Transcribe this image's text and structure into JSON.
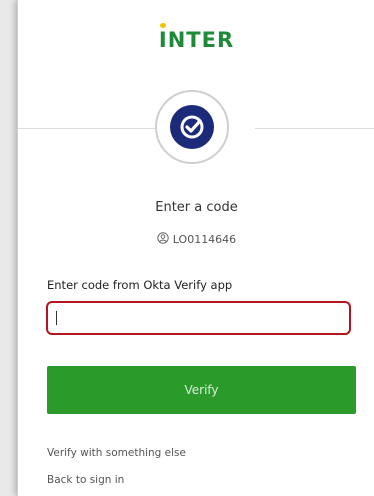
{
  "brand": {
    "logo_text": "INTER",
    "logo_color": "#1e8a3a",
    "logo_dot_color": "#f2c200"
  },
  "authenticator": {
    "icon": "okta-verify-check-icon",
    "icon_color": "#1c2a7a"
  },
  "header": {
    "title": "Enter a code",
    "user_icon": "user-circle-icon",
    "username": "LO0114646"
  },
  "form": {
    "code_label": "Enter code from Okta Verify app",
    "code_value": "",
    "code_placeholder": "",
    "error_border_color": "#b3141e",
    "verify_label": "Verify",
    "verify_color": "#2a9a2a"
  },
  "links": {
    "verify_else": "Verify with something else",
    "back_to_sign_in": "Back to sign in"
  }
}
